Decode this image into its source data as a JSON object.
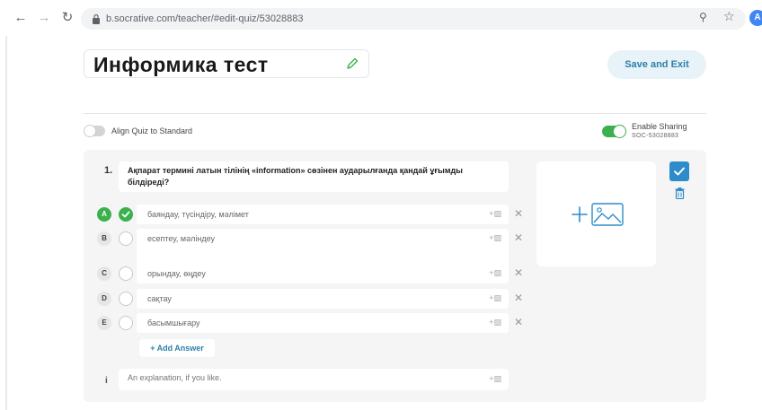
{
  "browser": {
    "url": "b.socrative.com/teacher/#edit-quiz/53028883",
    "profile_initial": "A"
  },
  "header": {
    "quiz_title": "Информика тест",
    "save_exit_label": "Save and Exit"
  },
  "settings": {
    "align_label": "Align Quiz to Standard",
    "align_enabled": false,
    "sharing_label": "Enable Sharing",
    "sharing_code": "SOC-53028883",
    "sharing_enabled": true
  },
  "question": {
    "number": "1.",
    "text": "Ақпарат термині латын тілінің «information» сөзінен аударылғанда қандай ұғымды білдіреді?",
    "answers": [
      {
        "letter": "A",
        "text": "баяндау, түсіндіру, мәлімет",
        "correct": true
      },
      {
        "letter": "B",
        "text": "есептеу, мәліндеу",
        "correct": false
      },
      {
        "letter": "C",
        "text": "орындау, өңдеу",
        "correct": false
      },
      {
        "letter": "D",
        "text": "сақтау",
        "correct": false
      },
      {
        "letter": "E",
        "text": "басымшығару",
        "correct": false
      }
    ],
    "add_image_glyph": "+▨",
    "remove_glyph": "✕",
    "add_answer_label": "+ Add Answer",
    "explanation_marker": "i",
    "explanation_placeholder": "An explanation, if you like."
  },
  "colors": {
    "accent": "#2c7fa8",
    "correct_green": "#3cb04c",
    "card_bg": "#f5f5f5"
  }
}
